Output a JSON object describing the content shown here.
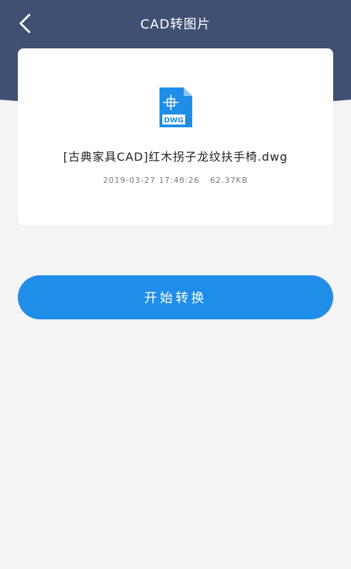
{
  "header": {
    "title": "CAD转图片",
    "back_icon": "chevron-left-icon",
    "background": "#3f5073"
  },
  "file": {
    "icon": "dwg-file-icon",
    "icon_label": "DWG",
    "name": "[古典家具CAD]红木拐子龙纹扶手椅.dwg",
    "date": "2019-03-27 17:48:26",
    "size": "62.37KB"
  },
  "actions": {
    "convert_label": "开始转换",
    "accent": "#1f8ee8"
  }
}
